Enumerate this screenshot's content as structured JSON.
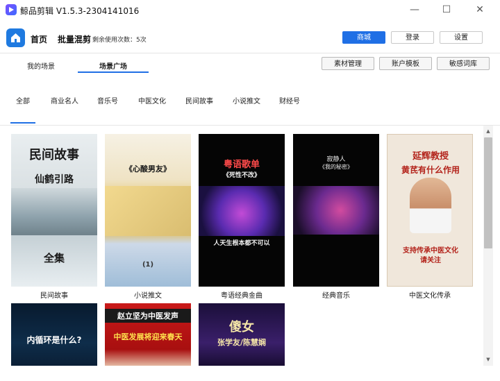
{
  "window": {
    "title": "鲸品剪辑 V1.5.3-2304141016"
  },
  "header": {
    "nav_home": "首页",
    "nav_batch": "批量混剪",
    "remaining": "剩余使用次数：5次",
    "btn_shop": "商城",
    "btn_login": "登录",
    "btn_settings": "设置"
  },
  "scene_tabs": {
    "my": "我的场景",
    "plaza": "场景广场"
  },
  "tools": {
    "material": "素材管理",
    "account": "账户模板",
    "sensitive": "敏感词库"
  },
  "categories": [
    "全部",
    "商业名人",
    "音乐号",
    "中医文化",
    "民间故事",
    "小说推文",
    "财经号"
  ],
  "cards": [
    {
      "caption": "民间故事",
      "t1": "民间故事",
      "t2": "仙鹤引路",
      "t3": "全集"
    },
    {
      "caption": "小说推文",
      "t1": "《心酸男友》",
      "t2": "(1)"
    },
    {
      "caption": "粤语经典金曲",
      "t1": "粤语歌单",
      "t2": "《死性不改》",
      "t3": "人天生根本都不可以"
    },
    {
      "caption": "经典音乐",
      "t1": "寂静人",
      "t2": "《我的秘密》"
    },
    {
      "caption": "中医文化传承",
      "t1": "延辉教授",
      "t2": "黄芪有什么作用",
      "t3": "支持传承中医文化",
      "t4": "请关注"
    },
    {
      "caption": "",
      "t1": "内循环是什么?"
    },
    {
      "caption": "",
      "t1": "赵立坚为中医发声",
      "t2": "中医发展将迎来春天"
    },
    {
      "caption": "",
      "t1": "傻女",
      "t2": "张学友/陈慧娴"
    }
  ],
  "colors": {
    "accent": "#1f6fe5",
    "home_icon": "#1f7ae0"
  }
}
